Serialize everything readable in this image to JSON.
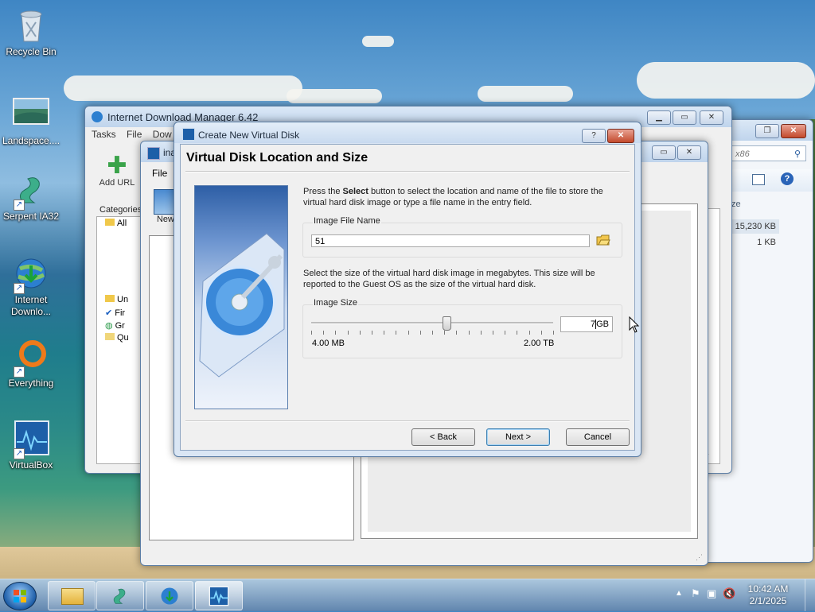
{
  "desktop": {
    "icons": [
      {
        "label": "Recycle Bin"
      },
      {
        "label": "Landspace...."
      },
      {
        "label": "Serpent IA32"
      },
      {
        "label": "Internet Downlo..."
      },
      {
        "label": "Everything"
      },
      {
        "label": "VirtualBox"
      }
    ]
  },
  "idm": {
    "title": "Internet Download Manager 6.42",
    "menu": [
      "Tasks",
      "File",
      "Dow"
    ],
    "toolbar": {
      "add_url": "Add URL",
      "new": "New"
    },
    "categories_label": "Categories",
    "tree": [
      "All",
      "Un",
      "Fir",
      "Gr",
      "Qu"
    ]
  },
  "vbox": {
    "title": "ina",
    "menu_file": "File"
  },
  "explorer": {
    "search_text": "x86",
    "col_size_fragment": "ze",
    "sizes": [
      "15,230 KB",
      "1 KB"
    ]
  },
  "dialog": {
    "title": "Create New Virtual Disk",
    "heading": "Virtual Disk Location and Size",
    "intro_pre": "Press the ",
    "intro_bold": "Select",
    "intro_post": " button to select the location and name of the file to store the virtual hard disk image or type a file name in the entry field.",
    "image_file_group": "Image File Name",
    "image_file_value": "51",
    "size_desc": "Select the size of the virtual hard disk image in megabytes. This size will be reported to the Guest OS as the size of the virtual hard disk.",
    "image_size_group": "Image Size",
    "slider_min": "4.00 MB",
    "slider_max": "2.00 TB",
    "slider_fraction": 0.56,
    "size_value": "7",
    "size_unit": "GB",
    "buttons": {
      "back": "< Back",
      "next": "Next >",
      "cancel": "Cancel"
    }
  },
  "taskbar": {
    "time": "10:42 AM",
    "date": "2/1/2025"
  }
}
